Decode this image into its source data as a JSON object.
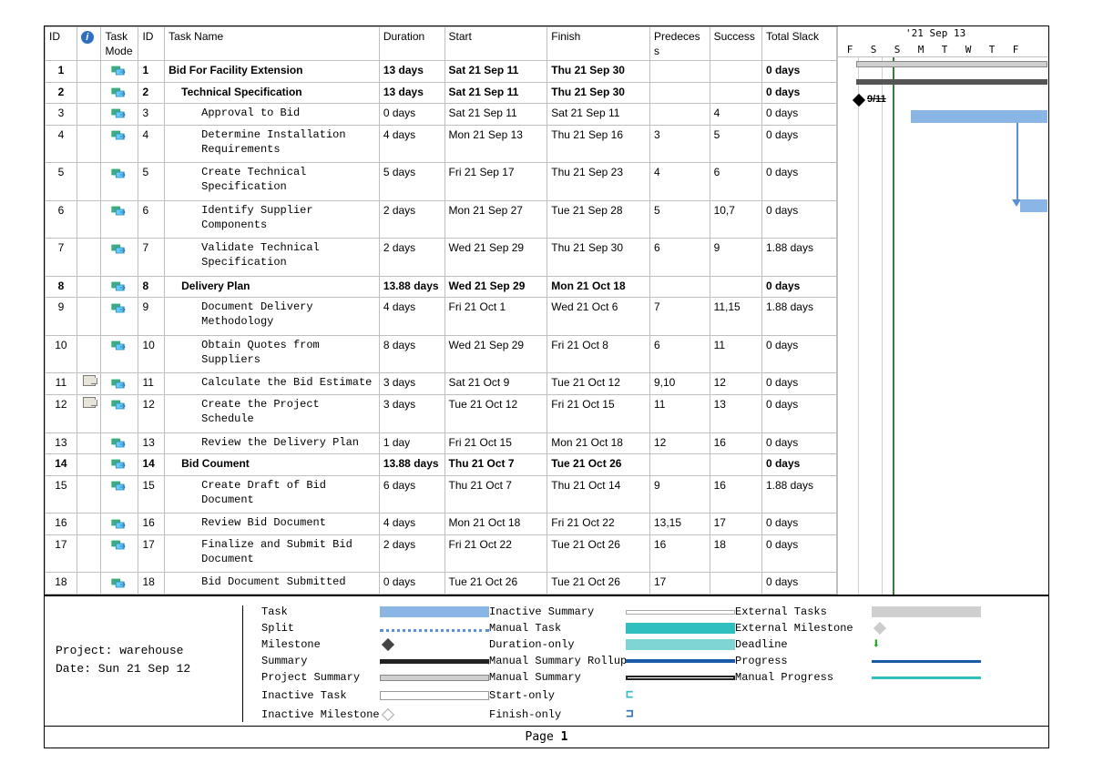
{
  "columns": {
    "id": "ID",
    "info": "",
    "mode": "Task Mode",
    "id2": "ID",
    "name": "Task Name",
    "duration": "Duration",
    "start": "Start",
    "finish": "Finish",
    "pred": "Predecess",
    "succ": "Success",
    "slack": "Total Slack"
  },
  "timeline": {
    "top_label": "'21 Sep 13",
    "days": [
      "F",
      "S",
      "S",
      "M",
      "T",
      "W",
      "T",
      "F"
    ]
  },
  "rows": [
    {
      "row": 1,
      "id": "1",
      "name": "Bid For Facility Extension",
      "indent": 0,
      "bold": true,
      "duration": "13 days",
      "start": "Sat 21 Sep 11",
      "finish": "Thu 21 Sep 30",
      "pred": "",
      "succ": "",
      "slack": "0 days",
      "note": false
    },
    {
      "row": 2,
      "id": "2",
      "name": "Technical Specification",
      "indent": 1,
      "bold": true,
      "duration": "13 days",
      "start": "Sat 21 Sep 11",
      "finish": "Thu 21 Sep 30",
      "pred": "",
      "succ": "",
      "slack": "0 days",
      "note": false
    },
    {
      "row": 3,
      "id": "3",
      "name": "Approval to Bid",
      "indent": 2,
      "bold": false,
      "duration": "0 days",
      "start": "Sat 21 Sep 11",
      "finish": "Sat 21 Sep 11",
      "pred": "",
      "succ": "4",
      "slack": "0 days",
      "note": false
    },
    {
      "row": 4,
      "id": "4",
      "name": "Determine Installation Requirements",
      "indent": 2,
      "bold": false,
      "duration": "4 days",
      "start": "Mon 21 Sep 13",
      "finish": "Thu 21 Sep 16",
      "pred": "3",
      "succ": "5",
      "slack": "0 days",
      "note": false
    },
    {
      "row": 5,
      "id": "5",
      "name": "Create Technical Specification",
      "indent": 2,
      "bold": false,
      "duration": "5 days",
      "start": "Fri 21 Sep 17",
      "finish": "Thu 21 Sep 23",
      "pred": "4",
      "succ": "6",
      "slack": "0 days",
      "note": false
    },
    {
      "row": 6,
      "id": "6",
      "name": "Identify Supplier Components",
      "indent": 2,
      "bold": false,
      "duration": "2 days",
      "start": "Mon 21 Sep 27",
      "finish": "Tue 21 Sep 28",
      "pred": "5",
      "succ": "10,7",
      "slack": "0 days",
      "note": false
    },
    {
      "row": 7,
      "id": "7",
      "name": "Validate Technical Specification",
      "indent": 2,
      "bold": false,
      "duration": "2 days",
      "start": "Wed 21 Sep 29",
      "finish": "Thu 21 Sep 30",
      "pred": "6",
      "succ": "9",
      "slack": "1.88 days",
      "note": false
    },
    {
      "row": 8,
      "id": "8",
      "name": "Delivery Plan",
      "indent": 1,
      "bold": true,
      "duration": "13.88 days",
      "start": "Wed 21 Sep 29",
      "finish": "Mon 21 Oct 18",
      "pred": "",
      "succ": "",
      "slack": "0 days",
      "note": false
    },
    {
      "row": 9,
      "id": "9",
      "name": "Document Delivery Methodology",
      "indent": 2,
      "bold": false,
      "duration": "4 days",
      "start": "Fri 21 Oct 1",
      "finish": "Wed 21 Oct 6",
      "pred": "7",
      "succ": "11,15",
      "slack": "1.88 days",
      "note": false
    },
    {
      "row": 10,
      "id": "10",
      "name": "Obtain Quotes from Suppliers",
      "indent": 2,
      "bold": false,
      "duration": "8 days",
      "start": "Wed 21 Sep 29",
      "finish": "Fri 21 Oct 8",
      "pred": "6",
      "succ": "11",
      "slack": "0 days",
      "note": false
    },
    {
      "row": 11,
      "id": "11",
      "name": "Calculate the Bid Estimate",
      "indent": 2,
      "bold": false,
      "duration": "3 days",
      "start": "Sat 21 Oct 9",
      "finish": "Tue 21 Oct 12",
      "pred": "9,10",
      "succ": "12",
      "slack": "0 days",
      "note": true
    },
    {
      "row": 12,
      "id": "12",
      "name": "Create the Project Schedule",
      "indent": 2,
      "bold": false,
      "duration": "3 days",
      "start": "Tue 21 Oct 12",
      "finish": "Fri 21 Oct 15",
      "pred": "11",
      "succ": "13",
      "slack": "0 days",
      "note": true
    },
    {
      "row": 13,
      "id": "13",
      "name": "Review the Delivery Plan",
      "indent": 2,
      "bold": false,
      "duration": "1 day",
      "start": "Fri 21 Oct 15",
      "finish": "Mon 21 Oct 18",
      "pred": "12",
      "succ": "16",
      "slack": "0 days",
      "note": false
    },
    {
      "row": 14,
      "id": "14",
      "name": "Bid Coument",
      "indent": 1,
      "bold": true,
      "duration": "13.88 days",
      "start": "Thu 21 Oct 7",
      "finish": "Tue 21 Oct 26",
      "pred": "",
      "succ": "",
      "slack": "0 days",
      "note": false
    },
    {
      "row": 15,
      "id": "15",
      "name": "Create Draft of Bid Document",
      "indent": 2,
      "bold": false,
      "duration": "6 days",
      "start": "Thu 21 Oct 7",
      "finish": "Thu 21 Oct 14",
      "pred": "9",
      "succ": "16",
      "slack": "1.88 days",
      "note": false
    },
    {
      "row": 16,
      "id": "16",
      "name": "Review Bid Document",
      "indent": 2,
      "bold": false,
      "duration": "4 days",
      "start": "Mon 21 Oct 18",
      "finish": "Fri 21 Oct 22",
      "pred": "13,15",
      "succ": "17",
      "slack": "0 days",
      "note": false
    },
    {
      "row": 17,
      "id": "17",
      "name": "Finalize and Submit Bid Document",
      "indent": 2,
      "bold": false,
      "duration": "2 days",
      "start": "Fri 21 Oct 22",
      "finish": "Tue 21 Oct 26",
      "pred": "16",
      "succ": "18",
      "slack": "0 days",
      "note": false
    },
    {
      "row": 18,
      "id": "18",
      "name": "Bid Document Submitted",
      "indent": 2,
      "bold": false,
      "duration": "0 days",
      "start": "Tue 21 Oct 26",
      "finish": "Tue 21 Oct 26",
      "pred": "17",
      "succ": "",
      "slack": "0 days",
      "note": false
    }
  ],
  "gantt": {
    "milestone_label": "9/11"
  },
  "legend": {
    "project_label": "Project: warehouse",
    "date_label": "Date: Sun 21 Sep 12",
    "items": {
      "task": "Task",
      "split": "Split",
      "milestone": "Milestone",
      "summary": "Summary",
      "proj_summary": "Project Summary",
      "inactive_task": "Inactive Task",
      "inactive_milestone": "Inactive Milestone",
      "inactive_summary": "Inactive Summary",
      "manual_task": "Manual Task",
      "duration_only": "Duration-only",
      "manual_summary_rollup": "Manual Summary Rollup",
      "manual_summary": "Manual Summary",
      "start_only": "Start-only",
      "finish_only": "Finish-only",
      "external_tasks": "External Tasks",
      "external_milestone": "External Milestone",
      "deadline": "Deadline",
      "progress": "Progress",
      "manual_progress": "Manual Progress"
    }
  },
  "footer": {
    "page_label": "Page",
    "page_no": "1"
  }
}
